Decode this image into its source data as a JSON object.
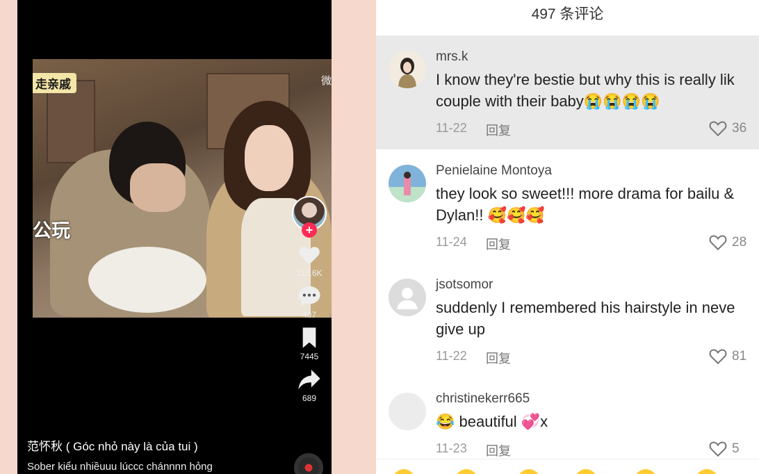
{
  "video": {
    "overlay_tag_top": "走亲戚",
    "overlay_tag_mid": "公玩",
    "watermark": "微",
    "likes": "112.6K",
    "comments": "497",
    "saves": "7445",
    "shares": "689",
    "caption_title": "范怀秋 ( Góc nhỏ này là của tui )",
    "caption_sub": "Sober kiểu nhiềuuu lúccc chánnnn hỏng"
  },
  "comments_panel": {
    "title": "497 条评论",
    "reply_label": "回复",
    "items": [
      {
        "user": "mrs.k",
        "text": "I know they're bestie but why this is really lik\ncouple with their baby😭😭😭😭",
        "date": "11-22",
        "likes": "36",
        "highlighted": true
      },
      {
        "user": "Penielaine Montoya",
        "text": "they look so sweet!!! more drama for bailu &\nDylan!! 🥰🥰🥰",
        "date": "11-24",
        "likes": "28",
        "highlighted": false
      },
      {
        "user": "jsotsomor",
        "text": "suddenly I remembered his hairstyle in neve\ngive up",
        "date": "11-22",
        "likes": "81",
        "highlighted": false
      },
      {
        "user": "christinekerr665",
        "text": "😂 beautiful 💞x",
        "date": "11-23",
        "likes": "5",
        "highlighted": false
      }
    ]
  },
  "colors": {
    "accent": "#fe2c55",
    "left_bg": "#f6d9cc",
    "highlight": "#e9e9e9"
  }
}
